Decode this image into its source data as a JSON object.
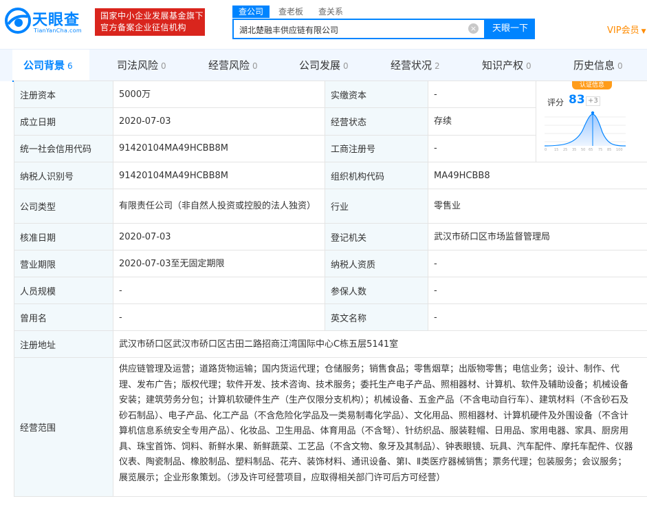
{
  "header": {
    "logo_text": "天眼查",
    "logo_sub": "TianYanCha.com",
    "slogan_line1": "国家中小企业发展基金旗下",
    "slogan_line2": "官方备案企业征信机构",
    "search_tabs": [
      "查公司",
      "查老板",
      "查关系"
    ],
    "search_value": "湖北楚融丰供应链有限公司",
    "search_button": "天眼一下",
    "vip_label": "VIP会员"
  },
  "nav": [
    {
      "label": "公司背景",
      "count": "6"
    },
    {
      "label": "司法风险",
      "count": "0"
    },
    {
      "label": "经营风险",
      "count": "0"
    },
    {
      "label": "公司发展",
      "count": "0"
    },
    {
      "label": "经营状况",
      "count": "2"
    },
    {
      "label": "知识产权",
      "count": "0"
    },
    {
      "label": "历史信息",
      "count": "0"
    }
  ],
  "score": {
    "badge": "认证信息",
    "label": "评分",
    "value": "83",
    "delta": "+3"
  },
  "info": {
    "reg_capital": {
      "label": "注册资本",
      "value": "5000万"
    },
    "paid_capital": {
      "label": "实缴资本",
      "value": "-"
    },
    "established": {
      "label": "成立日期",
      "value": "2020-07-03"
    },
    "status": {
      "label": "经营状态",
      "value": "存续"
    },
    "credit_code": {
      "label": "统一社会信用代码",
      "value": "91420104MA49HCBB8M"
    },
    "biz_reg_no": {
      "label": "工商注册号",
      "value": "-"
    },
    "taxpayer_id": {
      "label": "纳税人识别号",
      "value": "91420104MA49HCBB8M"
    },
    "org_code": {
      "label": "组织机构代码",
      "value": "MA49HCBB8"
    },
    "company_type": {
      "label": "公司类型",
      "value": "有限责任公司（非自然人投资或控股的法人独资）"
    },
    "industry": {
      "label": "行业",
      "value": "零售业"
    },
    "approval_date": {
      "label": "核准日期",
      "value": "2020-07-03"
    },
    "authority": {
      "label": "登记机关",
      "value": "武汉市硚口区市场监督管理局"
    },
    "term": {
      "label": "营业期限",
      "value": "2020-07-03至无固定期限"
    },
    "taxpayer_qual": {
      "label": "纳税人资质",
      "value": "-"
    },
    "staff_size": {
      "label": "人员规模",
      "value": "-"
    },
    "insured": {
      "label": "参保人数",
      "value": "-"
    },
    "former_name": {
      "label": "曾用名",
      "value": "-"
    },
    "english_name": {
      "label": "英文名称",
      "value": "-"
    },
    "address": {
      "label": "注册地址",
      "value": "武汉市硚口区武汉市硚口区古田二路招商江湾国际中心C栋五层5141室"
    },
    "scope": {
      "label": "经营范围",
      "value": "供应链管理及运营；道路货物运输；国内货运代理；仓储服务；销售食品；零售烟草；出版物零售；电信业务；设计、制作、代理、发布广告；版权代理；软件开发、技术咨询、技术服务；委托生产电子产品、照相器材、计算机、软件及辅助设备；机械设备安装；建筑劳务分包；计算机软硬件生产（生产仅限分支机构）；机械设备、五金产品（不含电动自行车）、建筑材料（不含砂石及砂石制品）、电子产品、化工产品（不含危险化学品及一类易制毒化学品）、文化用品、照相器材、计算机硬件及外围设备（不含计算机信息系统安全专用产品）、化妆品、卫生用品、体育用品（不含弩）、针纺织品、服装鞋帽、日用品、家用电器、家具、厨房用具、珠宝首饰、饲料、新鲜水果、新鲜蔬菜、工艺品（不含文物、象牙及其制品）、钟表眼镜、玩具、汽车配件、摩托车配件、仪器仪表、陶瓷制品、橡胶制品、塑料制品、花卉、装饰材料、通讯设备、第Ⅰ、Ⅱ类医疗器械销售；票务代理；包装服务；会议服务；展览展示；企业形象策划。（涉及许可经营项目，应取得相关部门许可后方可经营）"
    }
  }
}
